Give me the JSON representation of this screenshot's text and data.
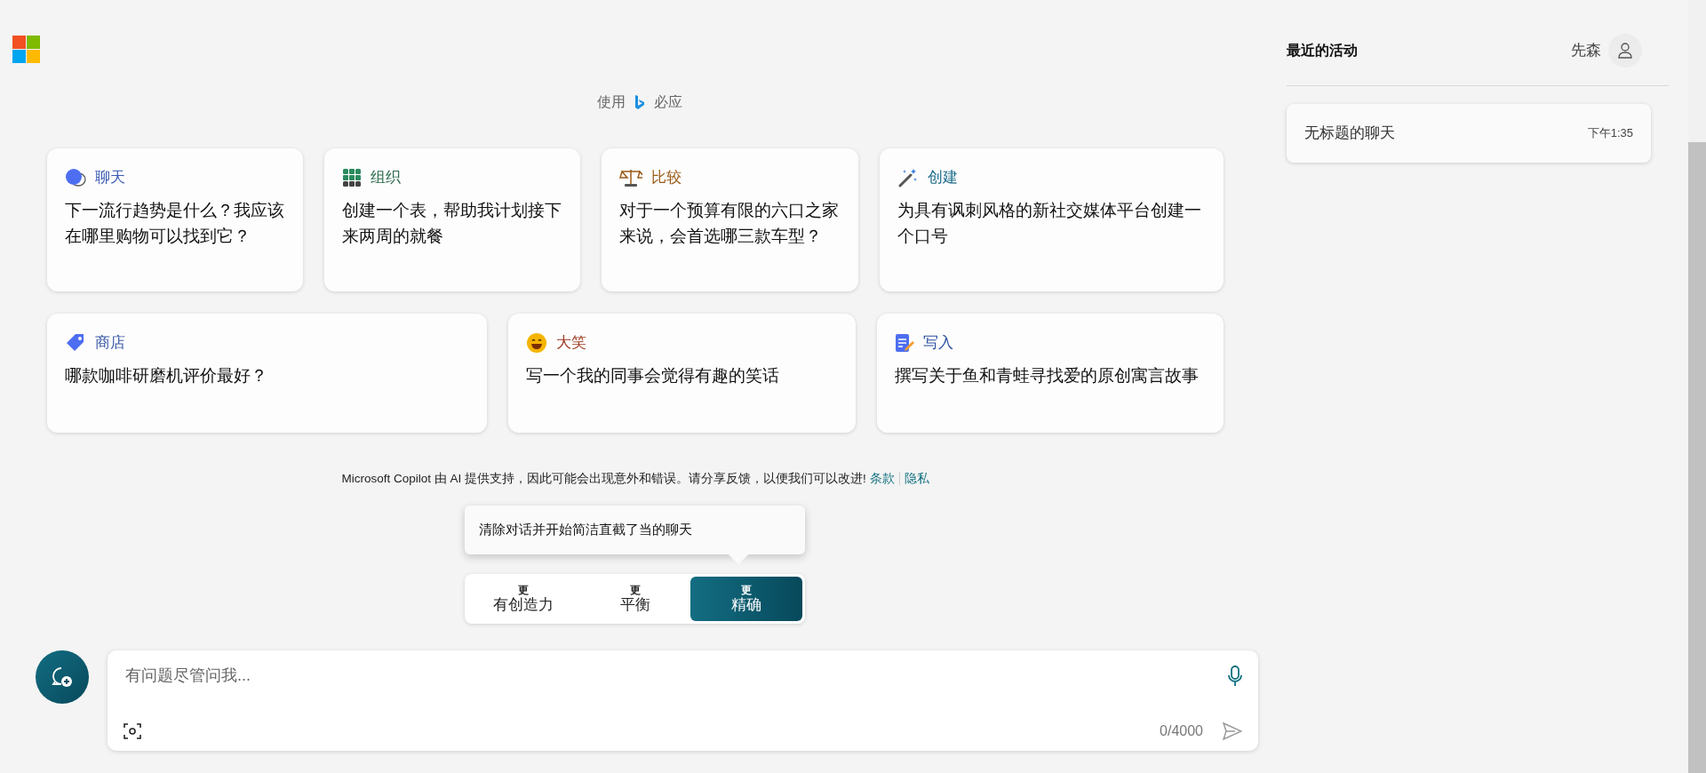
{
  "header": {
    "prefix": "使用",
    "brand": "必应"
  },
  "card_rows": [
    [
      {
        "kind": "chat",
        "title": "聊天",
        "color": "#3b5bb5",
        "text": "下一流行趋势是什么？我应该在哪里购物可以找到它？"
      },
      {
        "kind": "grid",
        "title": "组织",
        "color": "#2e6b4e",
        "text": "创建一个表，帮助我计划接下来两周的就餐"
      },
      {
        "kind": "scale",
        "title": "比较",
        "color": "#9a5a17",
        "text": "对于一个预算有限的六口之家来说，会首选哪三款车型？"
      },
      {
        "kind": "wand",
        "title": "创建",
        "color": "#1b6a8a",
        "text": "为具有讽刺风格的新社交媒体平台创建一个口号"
      }
    ],
    [
      {
        "kind": "tag",
        "title": "商店",
        "color": "#3b5aa8",
        "text": "哪款咖啡研磨机评价最好？"
      },
      {
        "kind": "smile",
        "title": "大笑",
        "color": "#9a3b1f",
        "text": "写一个我的同事会觉得有趣的笑话"
      },
      {
        "kind": "note",
        "title": "写入",
        "color": "#2a4fa0",
        "text": "撰写关于鱼和青蛙寻找爱的原创寓言故事"
      }
    ]
  ],
  "disclaimer": {
    "text": "Microsoft Copilot 由 AI 提供支持，因此可能会出现意外和错误。请分享反馈，以便我们可以改进!",
    "links": [
      "条款",
      "隐私"
    ]
  },
  "tooltip": "清除对话并开始简洁直截了当的聊天",
  "tones": [
    {
      "top": "更",
      "label": "有创造力",
      "selected": false
    },
    {
      "top": "更",
      "label": "平衡",
      "selected": false
    },
    {
      "top": "更",
      "label": "精确",
      "selected": true
    }
  ],
  "input": {
    "placeholder": "有问题尽管问我...",
    "counter": "0/4000"
  },
  "sidebar": {
    "title": "最近的活动",
    "user": "先森",
    "chats": [
      {
        "title": "无标题的聊天",
        "time": "下午1:35"
      }
    ]
  }
}
